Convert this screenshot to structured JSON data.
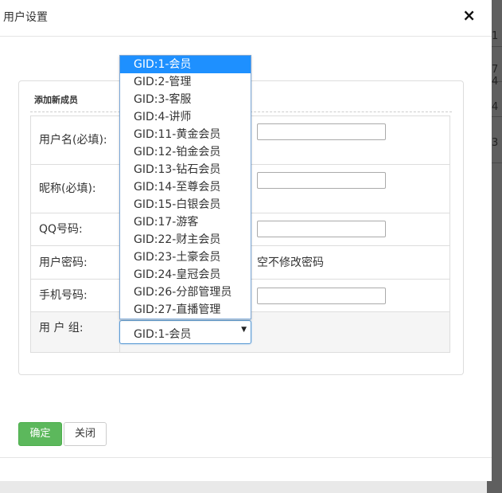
{
  "modal": {
    "title": "用户设置",
    "close": "×"
  },
  "background_page": {
    "fragments": [
      "1",
      "7 4",
      "4",
      "3"
    ]
  },
  "form": {
    "legend": "添加新成员",
    "rows": [
      {
        "label": "用户名(必填):",
        "value": ""
      },
      {
        "label": "昵称(必填):",
        "value": ""
      },
      {
        "label": "QQ号码:",
        "value": ""
      },
      {
        "label": "用户密码:",
        "hint": "空不修改密码"
      },
      {
        "label": "手机号码:",
        "value": ""
      },
      {
        "label": "用 户 组:"
      }
    ],
    "group_select": {
      "selected": "GID:1-会员",
      "options": [
        "GID:1-会员",
        "GID:2-管理",
        "GID:3-客服",
        "GID:4-讲师",
        "GID:11-黄金会员",
        "GID:12-铂金会员",
        "GID:13-钻石会员",
        "GID:14-至尊会员",
        "GID:15-白银会员",
        "GID:17-游客",
        "GID:22-财主会员",
        "GID:23-土豪会员",
        "GID:24-皇冠会员",
        "GID:26-分部管理员",
        "GID:27-直播管理"
      ],
      "highlighted_index": 0
    }
  },
  "buttons": {
    "ok": "确定",
    "close": "关闭"
  },
  "colors": {
    "ok_button": "#5cb85c",
    "option_highlight": "#1e90ff",
    "select_border": "#5b9bd5"
  }
}
